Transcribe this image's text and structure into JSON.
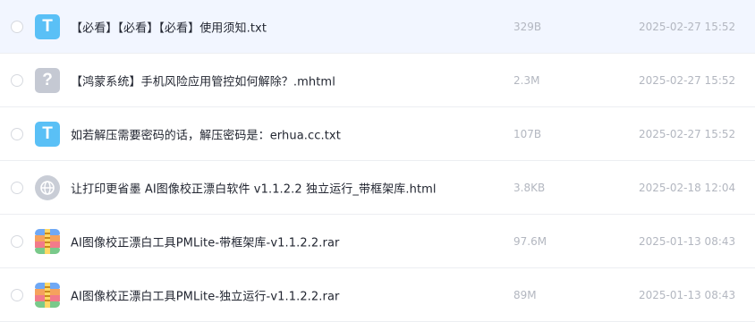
{
  "files": [
    {
      "name": "【必看】【必看】【必看】使用须知.txt",
      "size": "329B",
      "date": "2025-02-27 15:52",
      "icon": "txt-file-icon",
      "icon_glyph": "T"
    },
    {
      "name": "【鸿蒙系统】手机风险应用管控如何解除？.mhtml",
      "size": "2.3M",
      "date": "2025-02-27 15:52",
      "icon": "unknown-file-icon",
      "icon_glyph": "?"
    },
    {
      "name": "如若解压需要密码的话，解压密码是：erhua.cc.txt",
      "size": "107B",
      "date": "2025-02-27 15:52",
      "icon": "txt-file-icon",
      "icon_glyph": "T"
    },
    {
      "name": "让打印更省墨 AI图像校正漂白软件 v1.1.2.2 独立运行_带框架库.html",
      "size": "3.8KB",
      "date": "2025-02-18 12:04",
      "icon": "globe-file-icon"
    },
    {
      "name": "AI图像校正漂白工具PMLite-带框架库-v1.1.2.2.rar",
      "size": "97.6M",
      "date": "2025-01-13 08:43",
      "icon": "archive-file-icon"
    },
    {
      "name": "AI图像校正漂白工具PMLite-独立运行-v1.1.2.2.rar",
      "size": "89M",
      "date": "2025-01-13 08:43",
      "icon": "archive-file-icon"
    }
  ],
  "colors": {
    "selected_row_bg": "#f2f6ff",
    "txt_icon": "#5ac0f6",
    "unknown_icon": "#c5c9d3",
    "meta_text": "#b3b7c0",
    "name_text": "#222631"
  }
}
